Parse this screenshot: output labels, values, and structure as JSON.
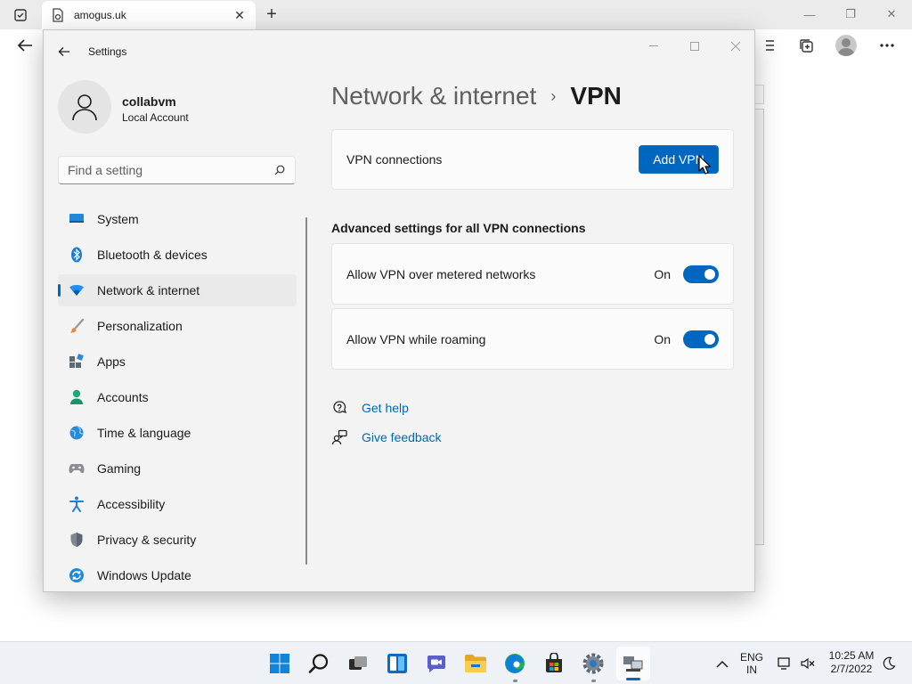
{
  "browser": {
    "tab_title": "amogus.uk",
    "tab_close": "✕",
    "new_tab": "+",
    "minimize": "—",
    "restore": "❐",
    "close": "✕"
  },
  "settings": {
    "window_title": "Settings",
    "profile": {
      "name": "collabvm",
      "account_type": "Local Account"
    },
    "search_placeholder": "Find a setting",
    "nav": [
      {
        "label": "System",
        "icon": "monitor-icon"
      },
      {
        "label": "Bluetooth & devices",
        "icon": "bluetooth-icon"
      },
      {
        "label": "Network & internet",
        "icon": "wifi-icon",
        "active": true
      },
      {
        "label": "Personalization",
        "icon": "brush-icon"
      },
      {
        "label": "Apps",
        "icon": "apps-icon"
      },
      {
        "label": "Accounts",
        "icon": "person-icon"
      },
      {
        "label": "Time & language",
        "icon": "globe-clock-icon"
      },
      {
        "label": "Gaming",
        "icon": "gamepad-icon"
      },
      {
        "label": "Accessibility",
        "icon": "accessibility-icon"
      },
      {
        "label": "Privacy & security",
        "icon": "shield-icon"
      },
      {
        "label": "Windows Update",
        "icon": "update-icon"
      }
    ],
    "breadcrumb": {
      "parent": "Network & internet",
      "separator": "›",
      "current": "VPN"
    },
    "vpn_connections": {
      "label": "VPN connections",
      "button": "Add VPN"
    },
    "advanced_title": "Advanced settings for all VPN connections",
    "toggles": [
      {
        "label": "Allow VPN over metered networks",
        "state": "On",
        "on": true
      },
      {
        "label": "Allow VPN while roaming",
        "state": "On",
        "on": true
      }
    ],
    "links": [
      {
        "label": "Get help",
        "icon": "help-icon"
      },
      {
        "label": "Give feedback",
        "icon": "feedback-icon"
      }
    ]
  },
  "taskbar": {
    "lang_line1": "ENG",
    "lang_line2": "IN",
    "time": "10:25 AM",
    "date": "2/7/2022",
    "accent": "#0067c0"
  }
}
